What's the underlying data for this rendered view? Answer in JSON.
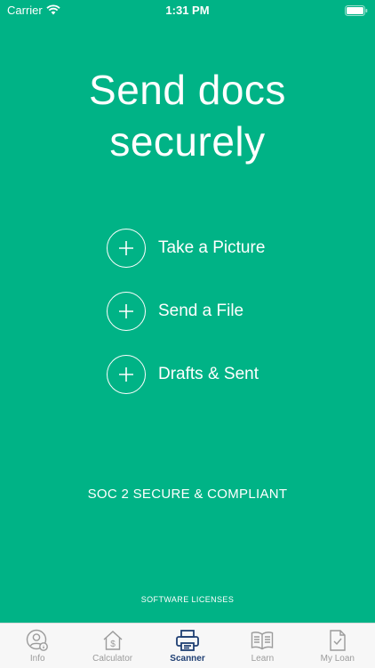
{
  "status_bar": {
    "carrier": "Carrier",
    "time": "1:31 PM"
  },
  "header": {
    "title_line1": "Send docs",
    "title_line2": "securely"
  },
  "actions": [
    {
      "label": "Take a Picture",
      "icon": "plus-icon"
    },
    {
      "label": "Send a File",
      "icon": "plus-icon"
    },
    {
      "label": "Drafts & Sent",
      "icon": "plus-icon"
    }
  ],
  "security_note": "SOC 2 SECURE & COMPLIANT",
  "licenses_link": "SOFTWARE LICENSES",
  "tab_bar": {
    "active_tab": "Scanner",
    "tabs": [
      {
        "label": "Info",
        "icon": "user-info-icon"
      },
      {
        "label": "Calculator",
        "icon": "house-dollar-icon"
      },
      {
        "label": "Scanner",
        "icon": "scanner-icon"
      },
      {
        "label": "Learn",
        "icon": "book-icon"
      },
      {
        "label": "My Loan",
        "icon": "document-check-icon"
      }
    ]
  },
  "colors": {
    "background": "#00B386",
    "tab_active": "#1F3F73",
    "tab_inactive": "#9B9B9B"
  }
}
